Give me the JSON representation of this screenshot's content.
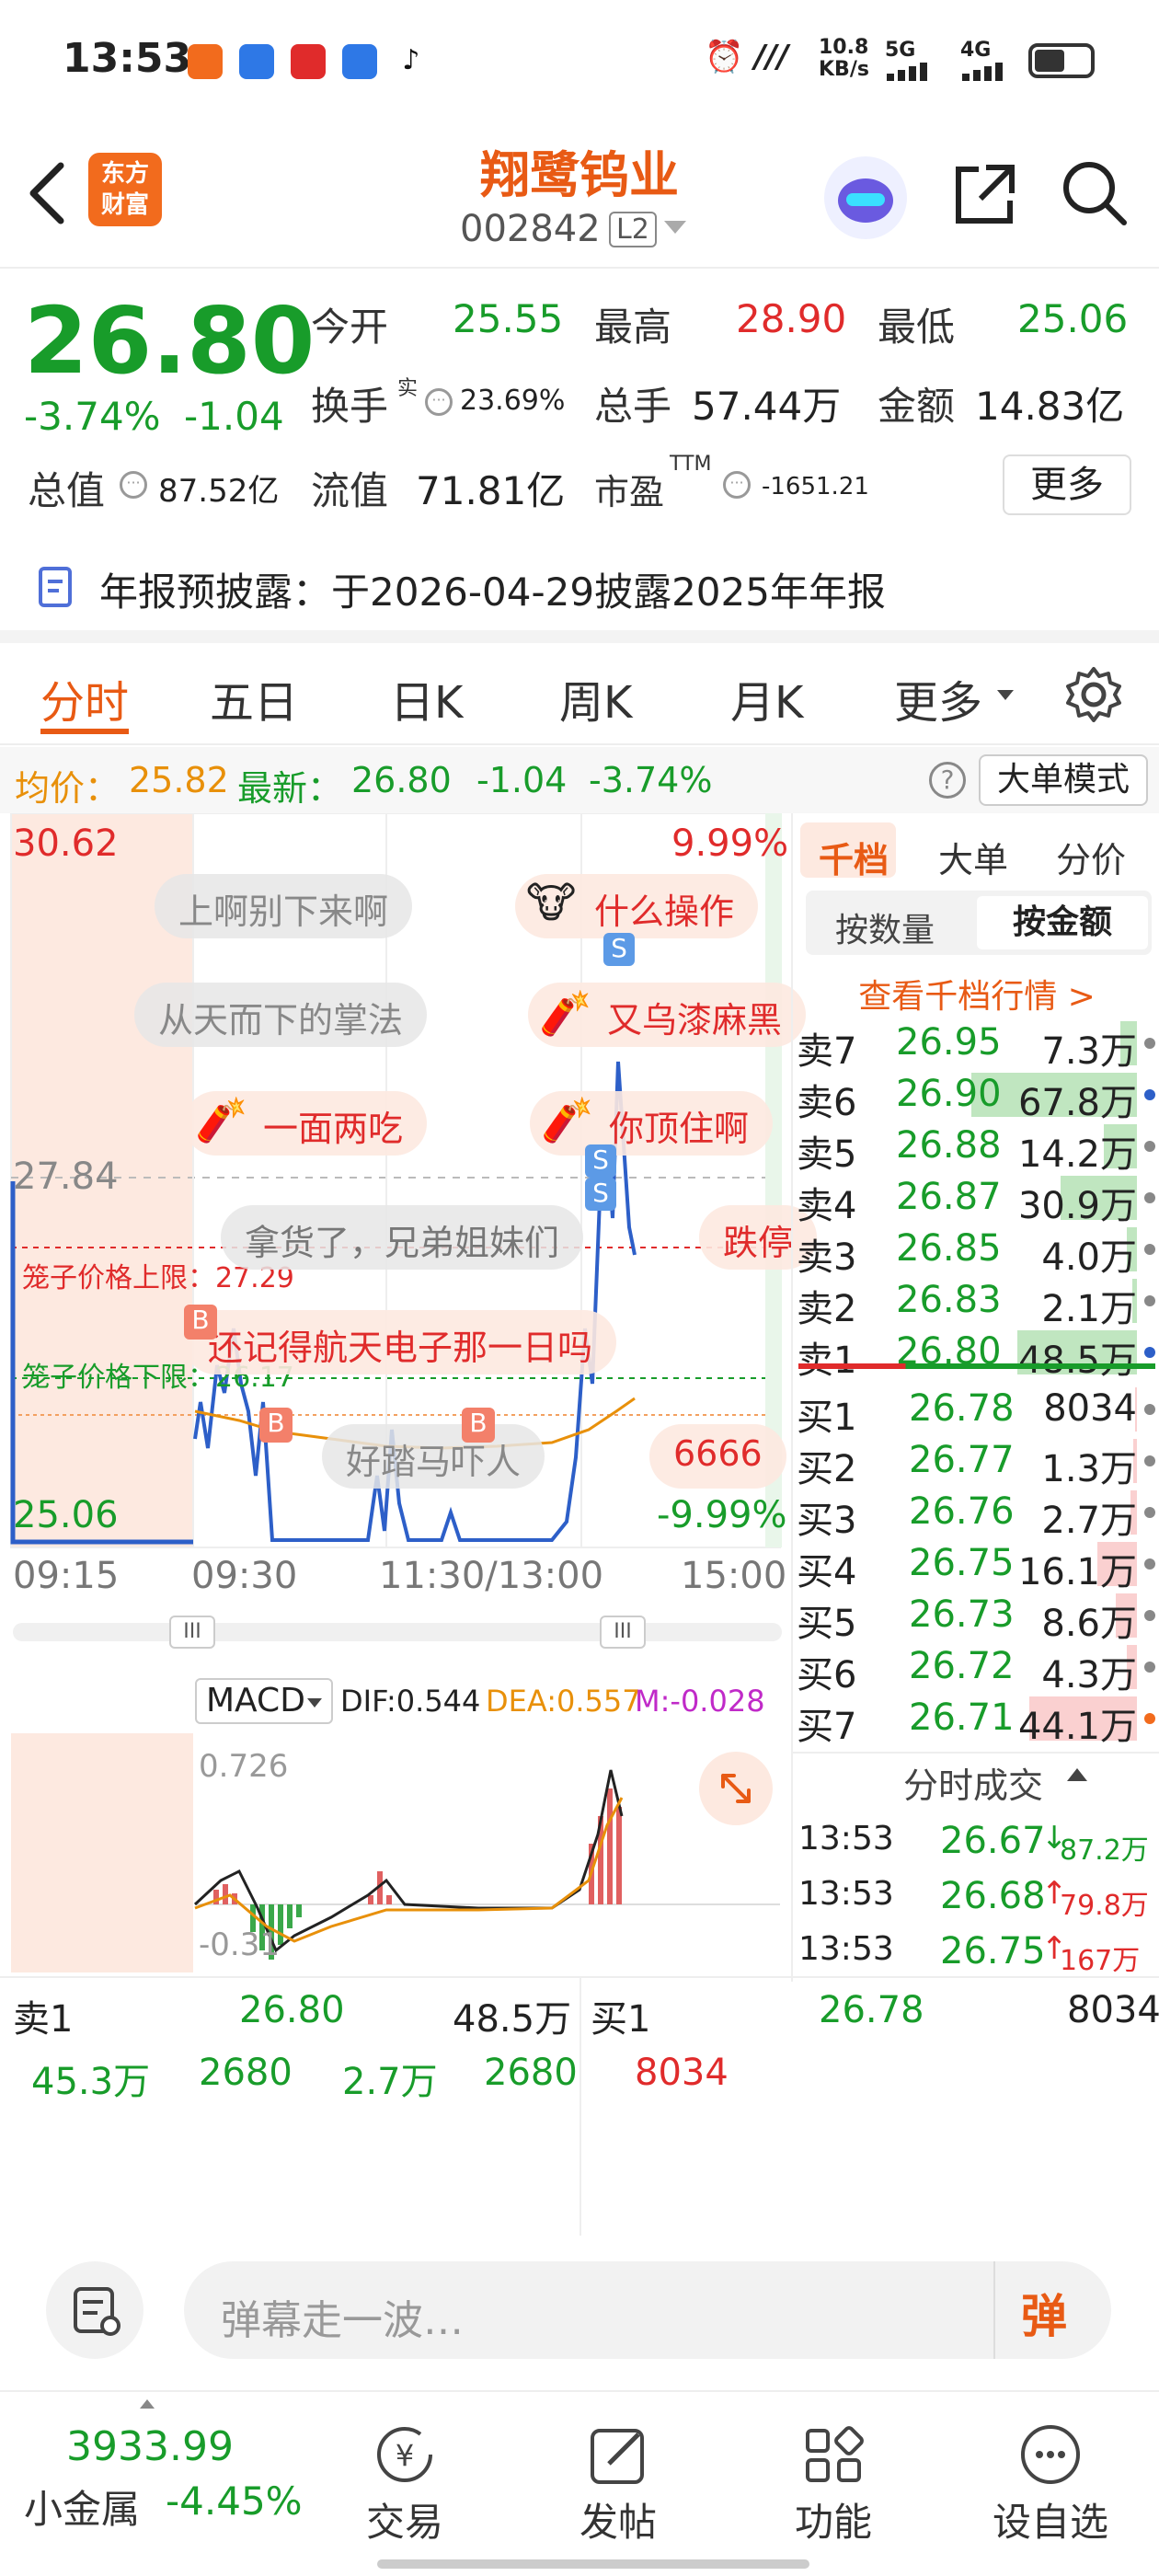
{
  "status_bar": {
    "time": "13:53",
    "network_speed": "10.8\nKB/s",
    "net1": "5G",
    "net2": "4G"
  },
  "header": {
    "title": "翔鹭钨业",
    "code": "002842",
    "level_badge": "L2",
    "logo": "东方\n财富"
  },
  "quote": {
    "price": "26.80",
    "change_pct": "-3.74%",
    "change": "-1.04",
    "open_label": "今开",
    "open": "25.55",
    "high_label": "最高",
    "high": "28.90",
    "low_label": "最低",
    "low": "25.06",
    "turnover_label": "换手",
    "turnover_sup": "实",
    "turnover": "23.69%",
    "volume_label": "总手",
    "volume": "57.44万",
    "amount_label": "金额",
    "amount": "14.83亿",
    "mktcap_label": "总值",
    "mktcap": "87.52亿",
    "float_label": "流值",
    "float": "71.81亿",
    "pe_label": "市盈",
    "pe_sup": "TTM",
    "pe": "-1651.21",
    "more_button": "更多"
  },
  "notice": {
    "text": "年报预披露：于2026-04-29披露2025年年报"
  },
  "tabs": [
    "分时",
    "五日",
    "日K",
    "周K",
    "月K",
    "更多"
  ],
  "avg_line": {
    "avg_label": "均价：",
    "avg": "25.82",
    "latest_label": "最新：",
    "latest": "26.80",
    "chg": "-1.04",
    "pct": "-3.74%",
    "mode_button": "大单模式"
  },
  "chart": {
    "y_top": "30.62",
    "y_mid": "27.84",
    "y_bottom": "25.06",
    "pct_top": "9.99%",
    "pct_bottom": "-9.99%",
    "x_labels": [
      "09:15",
      "09:30",
      "11:30/13:00",
      "15:00"
    ],
    "cage_upper": "笼子价格上限：27.29",
    "cage_lower": "笼子价格下限：26.17",
    "danmaku": [
      "上啊别下来啊",
      "什么操作",
      "从天而下的掌法",
      "又乌漆麻黑",
      "一面两吃",
      "你顶住啊",
      "拿货了，兄弟姐妹们",
      "跌停",
      "还记得航天电子那一日吗",
      "好踏马吓人",
      "6666"
    ],
    "markers": {
      "b": "B",
      "s": "S"
    },
    "slider_handle": "III"
  },
  "macd": {
    "selector": "MACD",
    "dif": "DIF:0.544",
    "dea": "DEA:0.557",
    "m": "M:-0.028",
    "top": "0.726",
    "bottom": "-0.31"
  },
  "order_book": {
    "tabs": [
      "千档",
      "大单",
      "分价"
    ],
    "toggle": [
      "按数量",
      "按金额"
    ],
    "link": "查看千档行情 >",
    "asks": [
      {
        "label": "卖7",
        "price": "26.95",
        "vol": "7.3万",
        "pct": 0.1
      },
      {
        "label": "卖6",
        "price": "26.90",
        "vol": "67.8万",
        "pct": 1.0
      },
      {
        "label": "卖5",
        "price": "26.88",
        "vol": "14.2万",
        "pct": 0.2
      },
      {
        "label": "卖4",
        "price": "26.87",
        "vol": "30.9万",
        "pct": 0.46
      },
      {
        "label": "卖3",
        "price": "26.85",
        "vol": "4.0万",
        "pct": 0.06
      },
      {
        "label": "卖2",
        "price": "26.83",
        "vol": "2.1万",
        "pct": 0.03
      },
      {
        "label": "卖1",
        "price": "26.80",
        "vol": "48.5万",
        "pct": 0.72
      }
    ],
    "bids": [
      {
        "label": "买1",
        "price": "26.78",
        "vol": "8034",
        "pct": 0.01
      },
      {
        "label": "买2",
        "price": "26.77",
        "vol": "1.3万",
        "pct": 0.02
      },
      {
        "label": "买3",
        "price": "26.76",
        "vol": "2.7万",
        "pct": 0.04
      },
      {
        "label": "买4",
        "price": "26.75",
        "vol": "16.1万",
        "pct": 0.24
      },
      {
        "label": "买5",
        "price": "26.73",
        "vol": "8.6万",
        "pct": 0.13
      },
      {
        "label": "买6",
        "price": "26.72",
        "vol": "4.3万",
        "pct": 0.06
      },
      {
        "label": "买7",
        "price": "26.71",
        "vol": "44.1万",
        "pct": 0.65
      }
    ],
    "trades_title": "分时成交",
    "trades": [
      {
        "time": "13:53",
        "price": "26.67",
        "vol": "87.2万",
        "dir": "↓"
      },
      {
        "time": "13:53",
        "price": "26.68",
        "vol": "79.8万",
        "dir": "↑"
      },
      {
        "time": "13:53",
        "price": "26.75",
        "vol": "167万",
        "dir": "↑"
      }
    ]
  },
  "bottom_quote": {
    "sell_label": "卖1",
    "sell_price": "26.80",
    "sell_vol": "48.5万",
    "buy_label": "买1",
    "buy_price": "26.78",
    "buy_vol": "8034",
    "sell_queue": [
      "45.3万",
      "2680",
      "2.7万",
      "2680"
    ],
    "buy_queue": [
      "8034"
    ]
  },
  "input_bar": {
    "placeholder": "弹幕走一波…",
    "dan_button": "弹"
  },
  "nav": {
    "index_value": "3933.99",
    "index_name": "小金属",
    "index_pct": "-4.45%",
    "items": [
      "交易",
      "发帖",
      "功能",
      "设自选"
    ]
  },
  "colors": {
    "red": "#e02b2b",
    "green": "#189c2a",
    "orange": "#f26b1d",
    "blue": "#2d5fc8"
  }
}
